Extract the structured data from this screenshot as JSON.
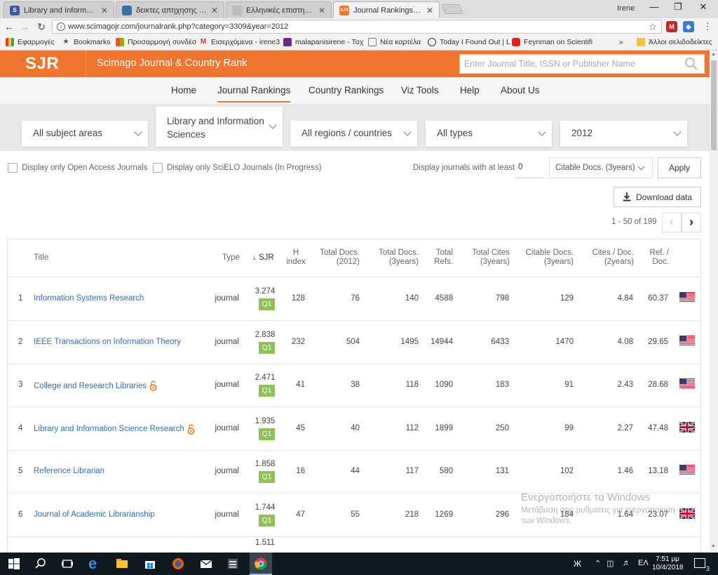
{
  "browser": {
    "tabs": [
      {
        "label": "Library and Information S",
        "favicon_color": "#3b5aa6",
        "favicon_text": "S",
        "active": false
      },
      {
        "label": "δεικτες απηχησης περιο",
        "favicon_color": "#3b6ea5",
        "favicon_text": "",
        "active": false
      },
      {
        "label": "Ελληνικές επιστημονικές",
        "favicon_color": "#bbbbbb",
        "favicon_text": "",
        "active": false
      },
      {
        "label": "Journal Rankings on Libr",
        "favicon_color": "#f0752f",
        "favicon_text": "SJR",
        "active": true
      }
    ],
    "user_name": "Irene",
    "url": "www.scimagojr.com/journalrank.php?category=3309&year=2012",
    "bookmarks": [
      {
        "label": "Εφαρμογές",
        "icon": "apps-icon"
      },
      {
        "label": "Bookmarks",
        "icon": "star-icon"
      },
      {
        "label": "Προσαρμογή συνδέσ",
        "icon": "windows-icon"
      },
      {
        "label": "Εισερχόμενα - irene3",
        "icon": "gmail-icon"
      },
      {
        "label": "malapanisirene - Ταχ",
        "icon": "mail-icon"
      },
      {
        "label": "Νέα καρτέλα",
        "icon": "page-icon"
      },
      {
        "label": "Today I Found Out | L",
        "icon": "globe-icon"
      },
      {
        "label": "Feynman on Scientifi",
        "icon": "youtube-icon"
      },
      {
        "label": "»",
        "icon": ""
      },
      {
        "label": "Άλλοι σελιδοδείκτες",
        "icon": "folder-icon"
      }
    ]
  },
  "site": {
    "logo": "SJR",
    "title": "Scimago Journal & Country Rank",
    "search_placeholder": "Enter Journal Title, ISSN or Publisher Name",
    "accent_color": "#f0752f",
    "nav": [
      "Home",
      "Journal Rankings",
      "Country Rankings",
      "Viz Tools",
      "Help",
      "About Us"
    ],
    "nav_active": "Journal Rankings"
  },
  "filters": {
    "subject_area": "All subject areas",
    "category_line1": "Library and Information",
    "category_line2": "Sciences",
    "region": "All regions / countries",
    "type": "All types",
    "year": "2012"
  },
  "options": {
    "open_access_label": "Display only Open Access Journals",
    "scielo_label": "Display only SciELO Journals (In Progress)",
    "min_label": "Display journals with at least",
    "min_value": "0",
    "min_metric": "Citable Docs. (3years)",
    "apply_label": "Apply",
    "download_label": "Download data",
    "page_info": "1 - 50 of 199"
  },
  "table": {
    "headers": {
      "title": "Title",
      "type": "Type",
      "sjr": "SJR",
      "h_index_1": "H",
      "h_index_2": "index",
      "total_docs_1": "Total Docs.",
      "total_docs_2": "(2012)",
      "total_docs3_1": "Total Docs.",
      "total_docs3_2": "(3years)",
      "refs_1": "Total",
      "refs_2": "Refs.",
      "cites_1": "Total Cites",
      "cites_2": "(3years)",
      "citable_1": "Citable Docs.",
      "citable_2": "(3years)",
      "cpd_1": "Cites / Doc.",
      "cpd_2": "(2years)",
      "rpd_1": "Ref. /",
      "rpd_2": "Doc."
    },
    "rows": [
      {
        "rank": "1",
        "title": "Information Systems Research",
        "open_access": false,
        "type": "journal",
        "sjr": "3.274",
        "quartile": "Q1",
        "h_index": "128",
        "docs_year": "76",
        "docs_3y": "140",
        "refs": "4588",
        "cites_3y": "798",
        "citable_3y": "129",
        "cites_per_doc": "4.84",
        "refs_per_doc": "60.37",
        "country": "us"
      },
      {
        "rank": "2",
        "title": "IEEE Transactions on Information Theory",
        "open_access": false,
        "type": "journal",
        "sjr": "2.838",
        "quartile": "Q1",
        "h_index": "232",
        "docs_year": "504",
        "docs_3y": "1495",
        "refs": "14944",
        "cites_3y": "6433",
        "citable_3y": "1470",
        "cites_per_doc": "4.08",
        "refs_per_doc": "29.65",
        "country": "us"
      },
      {
        "rank": "3",
        "title": "College and Research Libraries",
        "open_access": true,
        "type": "journal",
        "sjr": "2.471",
        "quartile": "Q1",
        "h_index": "41",
        "docs_year": "38",
        "docs_3y": "118",
        "refs": "1090",
        "cites_3y": "183",
        "citable_3y": "91",
        "cites_per_doc": "2.43",
        "refs_per_doc": "28.68",
        "country": "us"
      },
      {
        "rank": "4",
        "title": "Library and Information Science Research",
        "open_access": true,
        "type": "journal",
        "sjr": "1.935",
        "quartile": "Q1",
        "h_index": "45",
        "docs_year": "40",
        "docs_3y": "112",
        "refs": "1899",
        "cites_3y": "250",
        "citable_3y": "99",
        "cites_per_doc": "2.27",
        "refs_per_doc": "47.48",
        "country": "uk"
      },
      {
        "rank": "5",
        "title": "Reference Librarian",
        "open_access": false,
        "type": "journal",
        "sjr": "1.858",
        "quartile": "Q1",
        "h_index": "16",
        "docs_year": "44",
        "docs_3y": "117",
        "refs": "580",
        "cites_3y": "131",
        "citable_3y": "102",
        "cites_per_doc": "1.46",
        "refs_per_doc": "13.18",
        "country": "us"
      },
      {
        "rank": "6",
        "title": "Journal of Academic Librarianship",
        "open_access": false,
        "type": "journal",
        "sjr": "1.744",
        "quartile": "Q1",
        "h_index": "47",
        "docs_year": "55",
        "docs_3y": "218",
        "refs": "1269",
        "cites_3y": "296",
        "citable_3y": "184",
        "cites_per_doc": "1.64",
        "refs_per_doc": "23.07",
        "country": "uk"
      },
      {
        "rank": "",
        "title": "",
        "open_access": false,
        "type": "",
        "sjr": "1.511",
        "quartile": "",
        "h_index": "",
        "docs_year": "",
        "docs_3y": "",
        "refs": "",
        "cites_3y": "",
        "citable_3y": "",
        "cites_per_doc": "",
        "refs_per_doc": "",
        "country": ""
      }
    ]
  },
  "watermark": {
    "line1": "Ενεργοποιήστε τα Windows",
    "line2": "Μετάβαση στις ρυθμίσεις για ενεργοποίηση των Windows."
  },
  "taskbar": {
    "language": "ΕΛ",
    "time": "7:51 μμ",
    "date": "10/4/2018",
    "notification_count": "3"
  }
}
